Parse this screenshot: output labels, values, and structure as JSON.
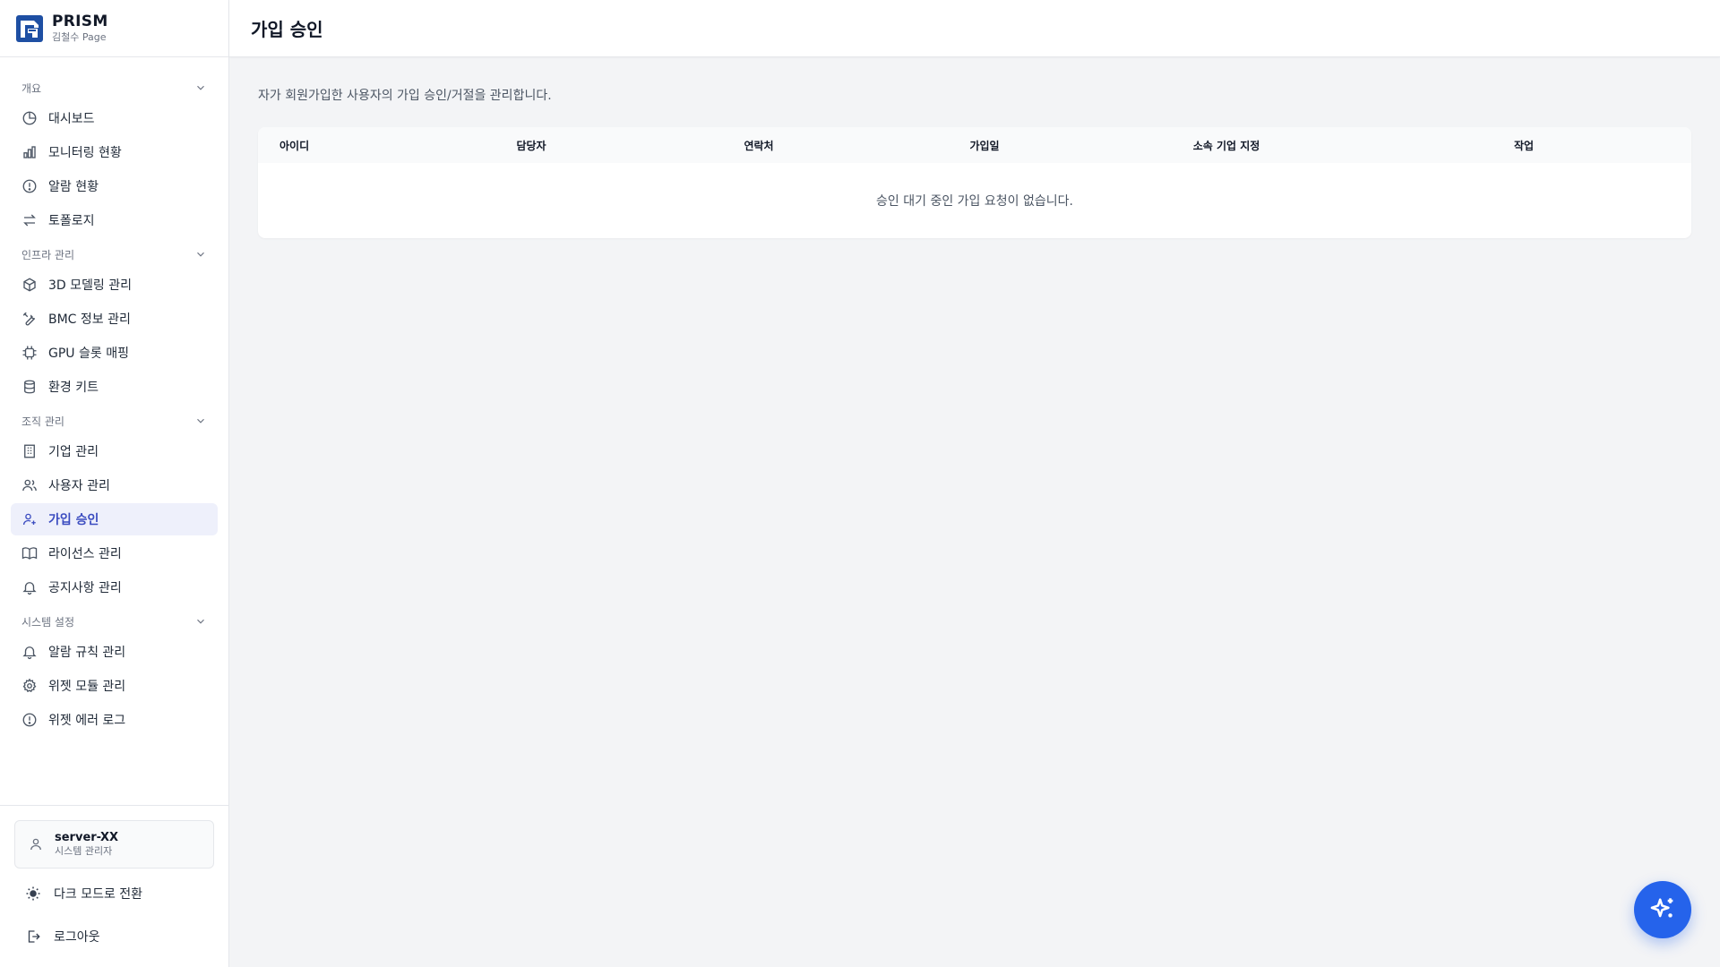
{
  "brand": {
    "title": "PRISM",
    "subtitle": "김철수 Page"
  },
  "sidebar": {
    "sections": [
      {
        "title": "개요",
        "items": [
          {
            "label": "대시보드",
            "icon": "pie-chart-icon"
          },
          {
            "label": "모니터링 현황",
            "icon": "bar-chart-icon"
          },
          {
            "label": "알람 현황",
            "icon": "alert-circle-icon"
          },
          {
            "label": "토폴로지",
            "icon": "arrows-swap-icon"
          }
        ]
      },
      {
        "title": "인프라 관리",
        "items": [
          {
            "label": "3D 모델링 관리",
            "icon": "cube-icon"
          },
          {
            "label": "BMC 정보 관리",
            "icon": "wrench-icon"
          },
          {
            "label": "GPU 슬롯 매핑",
            "icon": "chip-icon"
          },
          {
            "label": "환경 키트",
            "icon": "database-icon"
          }
        ]
      },
      {
        "title": "조직 관리",
        "items": [
          {
            "label": "기업 관리",
            "icon": "building-icon"
          },
          {
            "label": "사용자 관리",
            "icon": "users-icon"
          },
          {
            "label": "가입 승인",
            "icon": "user-plus-icon",
            "active": true
          },
          {
            "label": "라이선스 관리",
            "icon": "book-icon"
          },
          {
            "label": "공지사항 관리",
            "icon": "bell-icon"
          }
        ]
      },
      {
        "title": "시스템 설정",
        "items": [
          {
            "label": "알람 규칙 관리",
            "icon": "bell-icon"
          },
          {
            "label": "위젯 모듈 관리",
            "icon": "gear-icon"
          },
          {
            "label": "위젯 에러 로그",
            "icon": "alert-circle-icon"
          }
        ]
      }
    ]
  },
  "user": {
    "name": "server-XX",
    "role": "시스템 관리자"
  },
  "footer": {
    "dark_mode_label": "다크 모드로 전환",
    "logout_label": "로그아웃"
  },
  "page": {
    "title": "가입 승인",
    "description": "자가 회원가입한 사용자의 가입 승인/거절을 관리합니다.",
    "table": {
      "headers": [
        "아이디",
        "담당자",
        "연락처",
        "가입일",
        "소속 기업 지정",
        "작업"
      ],
      "empty_message": "승인 대기 중인 가입 요청이 없습니다."
    }
  },
  "colors": {
    "accent": "#3b4cc0",
    "active_bg": "#eef0fb",
    "fab": "#2563eb"
  },
  "fab": {
    "icon": "sparkles-icon"
  }
}
